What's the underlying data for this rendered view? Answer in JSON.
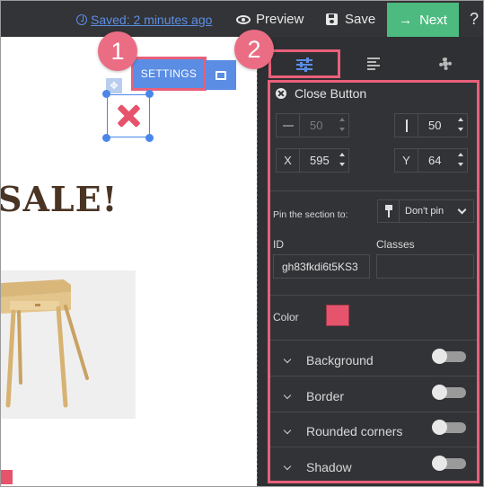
{
  "topbar": {
    "saved_text": "Saved: 2 minutes ago",
    "preview_label": "Preview",
    "save_label": "Save",
    "next_label": "Next",
    "help_label": "?"
  },
  "canvas": {
    "headline": "SALE!",
    "settings_label": "SETTINGS"
  },
  "badges": {
    "first": "1",
    "second": "2"
  },
  "panel": {
    "tabs": [
      {
        "icon": "sliders-icon"
      },
      {
        "icon": "text-align-icon"
      },
      {
        "icon": "gear-icon"
      }
    ],
    "title": "Close Button",
    "width_value": "50",
    "height_value": "50",
    "x_label": "X",
    "x_value": "595",
    "y_label": "Y",
    "y_value": "64",
    "pin_label": "Pin the section to:",
    "pin_value": "Don't pin",
    "id_label": "ID",
    "id_value": "gh83fkdi6t5KS3",
    "classes_label": "Classes",
    "classes_value": "",
    "color_label": "Color",
    "color_value": "#e5546c",
    "sections": [
      {
        "label": "Background"
      },
      {
        "label": "Border"
      },
      {
        "label": "Rounded corners"
      },
      {
        "label": "Shadow"
      }
    ]
  },
  "colors": {
    "accent_pink": "#e8607a",
    "next_green": "#4dbb80",
    "settings_blue": "#5a8de3",
    "panel_bg": "#2f3033"
  }
}
